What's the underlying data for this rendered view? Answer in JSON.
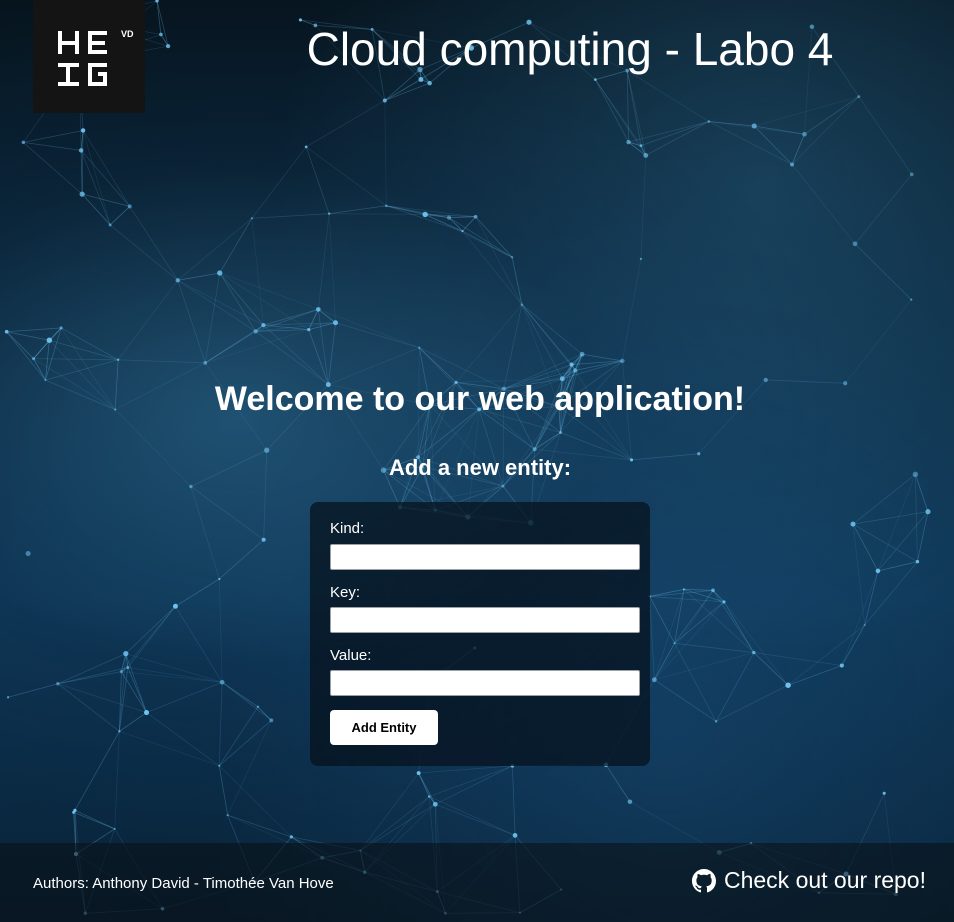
{
  "header": {
    "logo_text": "HEIG-VD",
    "title": "Cloud computing - Labo 4"
  },
  "main": {
    "welcome": "Welcome to our web application!",
    "form_heading": "Add a new entity:",
    "form": {
      "kind_label": "Kind:",
      "kind_value": "",
      "key_label": "Key:",
      "key_value": "",
      "value_label": "Value:",
      "value_value": "",
      "submit_label": "Add Entity"
    }
  },
  "footer": {
    "authors": "Authors: Anthony David - Timothée Van Hove",
    "repo_link": "Check out our repo!",
    "repo_icon": "github-icon"
  },
  "colors": {
    "background": "#0b2a40",
    "node": "#6fc3f0",
    "logo_bg": "#141414"
  }
}
